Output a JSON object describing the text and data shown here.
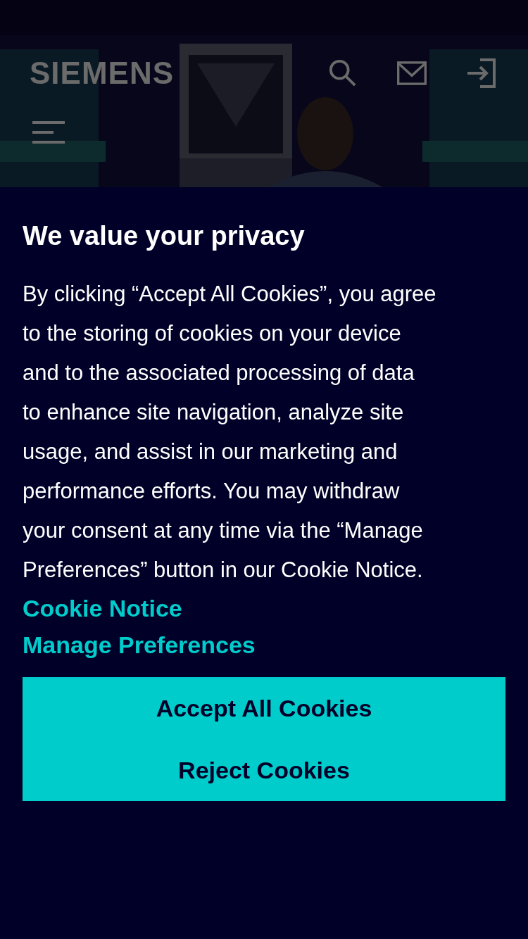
{
  "header": {
    "logo": "SIEMENS"
  },
  "consent": {
    "title": "We value your privacy",
    "body": "By clicking “Accept All Cookies”, you agree to the storing of cookies on your device and to the associated processing of data to enhance site navigation, analyze site usage, and assist in our marketing and performance efforts. You may withdraw your consent at any time via the “Manage Preferences” button in our Cookie Notice.",
    "links": [
      {
        "label": "Cookie Notice"
      },
      {
        "label": "Manage Preferences"
      }
    ],
    "buttons": [
      {
        "label": "Accept All Cookies"
      },
      {
        "label": "Reject Cookies"
      }
    ]
  }
}
